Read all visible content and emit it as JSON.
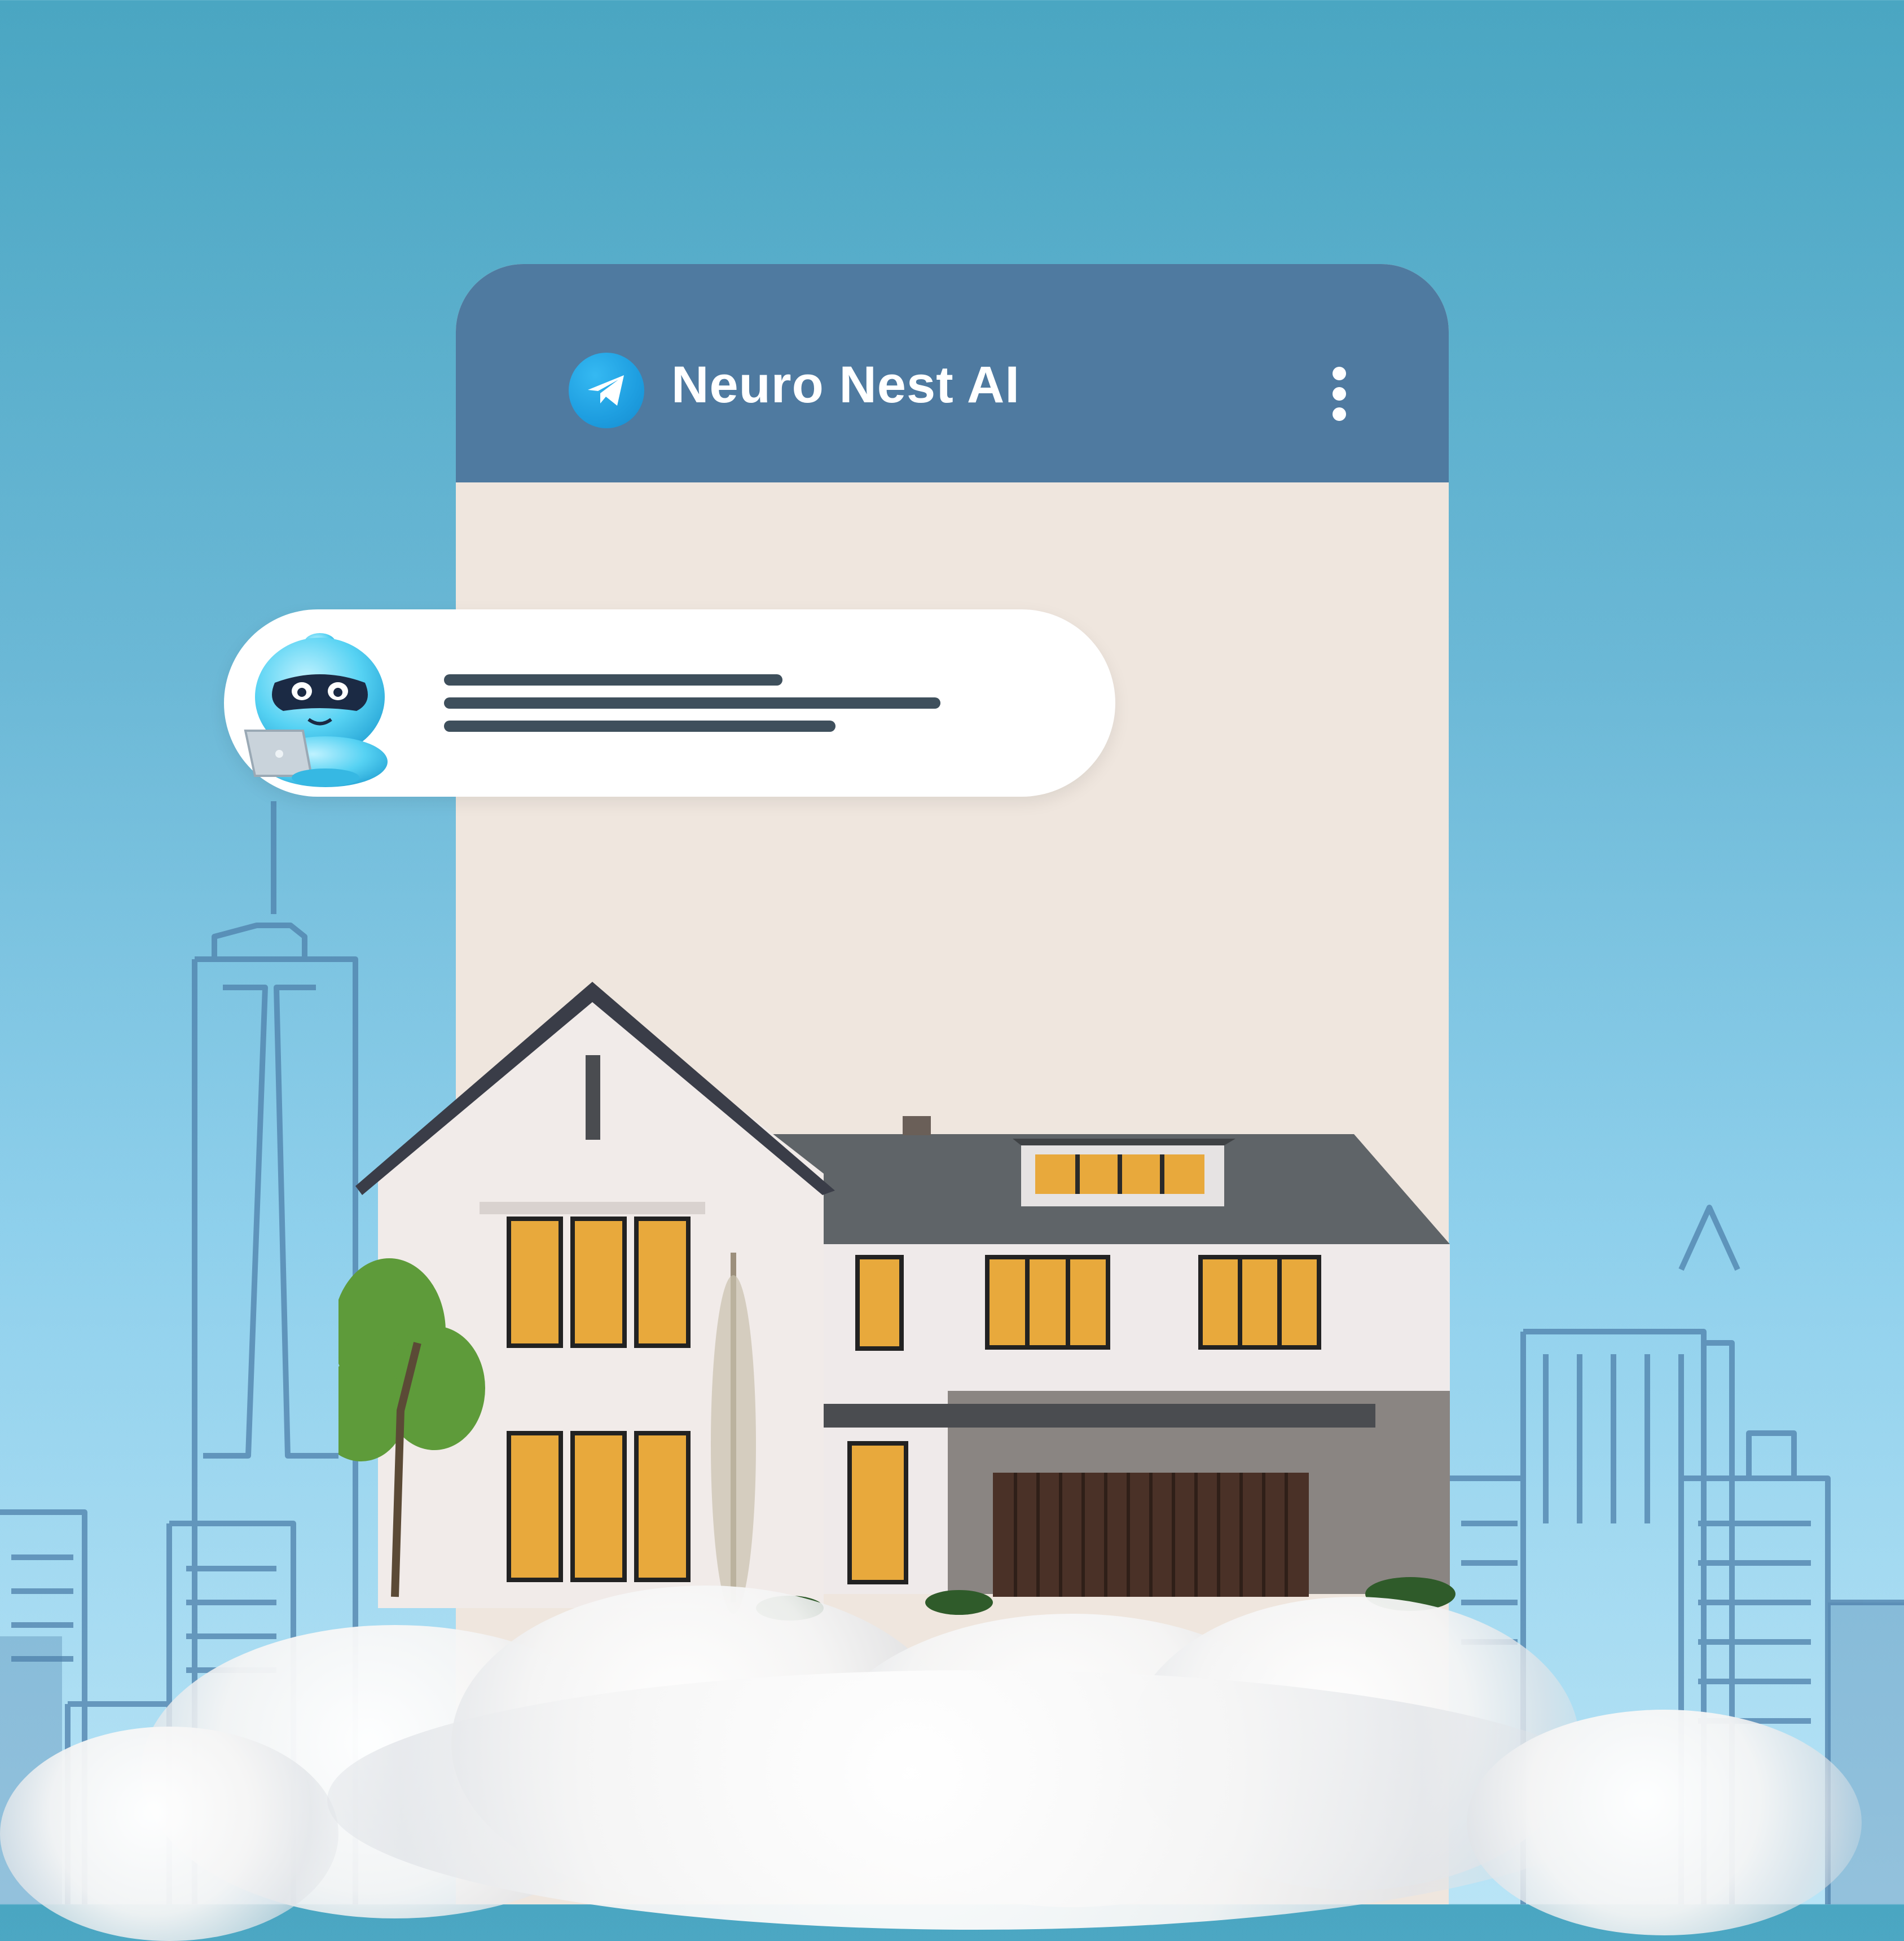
{
  "app": {
    "title": "Neuro Nest AI",
    "icon": "telegram-paper-plane-icon",
    "menu_icon": "vertical-dots-icon"
  },
  "chat": {
    "message_avatar": "robot-with-laptop-avatar",
    "message_placeholder_lines": 3
  },
  "colors": {
    "header": "#4f7aa0",
    "chat_background": "#efe6de",
    "bubble": "#ffffff",
    "placeholder_text": "#3e4f5c",
    "accent": "#1e9ee0"
  }
}
